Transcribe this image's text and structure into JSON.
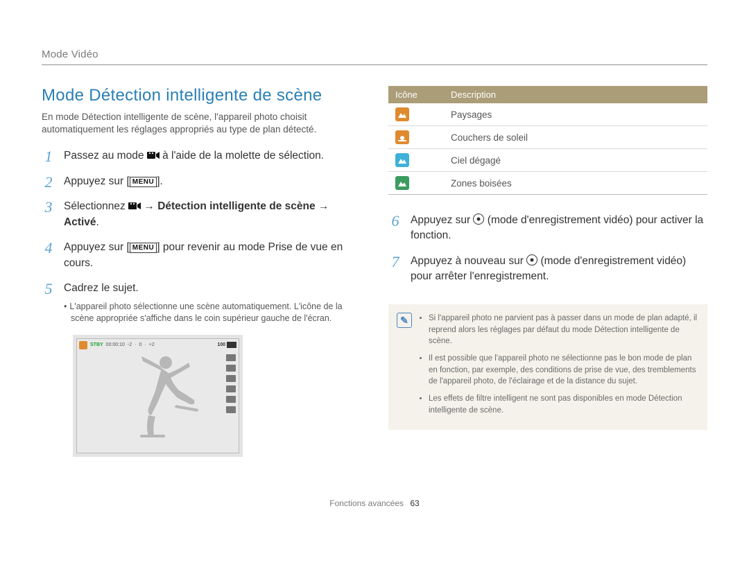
{
  "breadcrumb": "Mode Vidéo",
  "title": "Mode Détection intelligente de scène",
  "intro": "En mode Détection intelligente de scène, l'appareil photo choisit automatiquement les réglages appropriés au type de plan détecté.",
  "steps": {
    "s1_a": "Passez au mode ",
    "s1_b": " à l'aide de la molette de sélection.",
    "s2_a": "Appuyez sur [",
    "s2_b": "].",
    "s3_a": "Sélectionnez ",
    "s3_arrow1": " → ",
    "s3_b": "Détection intelligente de scène",
    "s3_arrow2": " → ",
    "s3_c": "Activé",
    "s3_d": ".",
    "s4_a": "Appuyez sur [",
    "s4_b": "] pour revenir au mode Prise de vue en cours.",
    "s5_a": "Cadrez le sujet.",
    "s5_sub": "L'appareil photo sélectionne une scène automatiquement. L'icône de la scène appropriée s'affiche dans le coin supérieur gauche de l'écran.",
    "s6_a": "Appuyez sur ",
    "s6_b": " (mode d'enregistrement vidéo) pour activer la fonction.",
    "s7_a": "Appuyez à nouveau sur ",
    "s7_b": " (mode d'enregistrement vidéo) pour arrêter l'enregistrement."
  },
  "menu_label": "MENU",
  "preview": {
    "stby": "STBY",
    "time": "00:00:10",
    "exp_minus": "-2",
    "exp_zero": "0",
    "exp_plus": "+2",
    "batt_pct": "100"
  },
  "table": {
    "head_icon": "Icône",
    "head_desc": "Description",
    "rows": [
      {
        "desc": "Paysages",
        "color": "#e08a2e",
        "glyph": "landscape"
      },
      {
        "desc": "Couchers de soleil",
        "color": "#e08a2e",
        "glyph": "sunset"
      },
      {
        "desc": "Ciel dégagé",
        "color": "#3fb1d8",
        "glyph": "landscape"
      },
      {
        "desc": "Zones boisées",
        "color": "#3a9c5f",
        "glyph": "landscape"
      }
    ]
  },
  "notes": [
    "Si l'appareil photo ne parvient pas à passer dans un mode de plan adapté, il reprend alors les réglages par défaut du mode Détection intelligente de scène.",
    "Il est possible que l'appareil photo ne sélectionne pas le bon mode de plan en fonction, par exemple, des conditions de prise de vue, des tremblements de l'appareil photo, de l'éclairage et de la distance du sujet.",
    "Les effets de filtre intelligent ne sont pas disponibles en mode Détection intelligente de scène."
  ],
  "footer_section": "Fonctions avancées",
  "footer_page": "63",
  "chart_data": {
    "type": "table",
    "note": "No quantitative chart; main data is the icon/description table above."
  }
}
